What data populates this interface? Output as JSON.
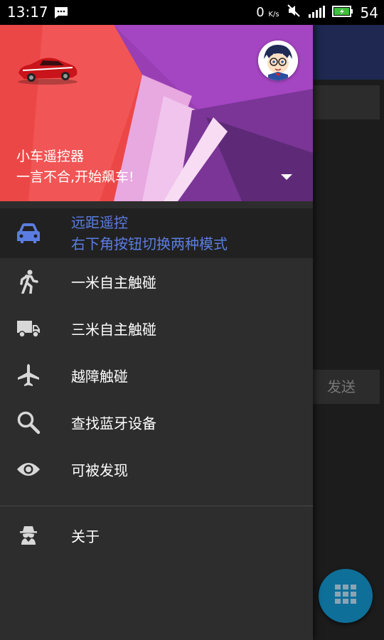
{
  "status_bar": {
    "time": "13:17",
    "speed": "0",
    "speed_unit": "K/s",
    "battery": "54"
  },
  "background": {
    "send_label": "发送",
    "fab_icon": "grid-icon"
  },
  "drawer": {
    "header": {
      "title": "小车遥控器",
      "subtitle": "一言不合,开始飙车!"
    },
    "menu": [
      {
        "label": "远距遥控",
        "sublabel": "右下角按钮切换两种模式",
        "icon": "car-icon",
        "selected": true
      },
      {
        "label": "一米自主触碰",
        "icon": "walk-icon"
      },
      {
        "label": "三米自主触碰",
        "icon": "truck-icon"
      },
      {
        "label": "越障触碰",
        "icon": "airplane-icon"
      },
      {
        "label": "查找蓝牙设备",
        "icon": "search-icon"
      },
      {
        "label": "可被发现",
        "icon": "eye-icon"
      }
    ],
    "about": {
      "label": "关于",
      "icon": "spy-icon"
    }
  },
  "colors": {
    "accent": "#5b7de2",
    "fab": "#0e6f99",
    "drawer_bg": "#2d2d2d"
  }
}
